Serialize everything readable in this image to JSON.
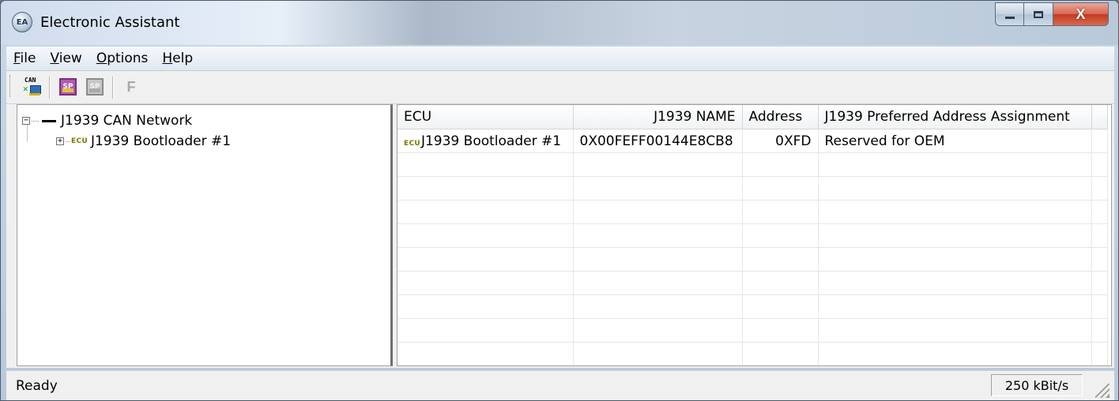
{
  "window": {
    "title": "Electronic Assistant",
    "app_icon": "ea-logo-icon",
    "controls": {
      "minimize": "minimize-icon",
      "maximize": "maximize-icon",
      "close": "close-icon",
      "close_glyph": "X"
    }
  },
  "menu": [
    {
      "label": "File",
      "accel": "F",
      "rest": "ile"
    },
    {
      "label": "View",
      "accel": "V",
      "rest": "iew"
    },
    {
      "label": "Options",
      "accel": "O",
      "rest": "ptions"
    },
    {
      "label": "Help",
      "accel": "H",
      "rest": "elp"
    }
  ],
  "toolbar": {
    "can_icon_text": "CAN",
    "sp_icon_text": "SP",
    "f_label": "F"
  },
  "tree": {
    "root": {
      "expander": "−",
      "label": "J1939 CAN Network"
    },
    "child": {
      "expander": "+",
      "icon_text": "ECU",
      "label": "J1939 Bootloader #1"
    }
  },
  "table": {
    "columns": [
      "ECU",
      "J1939 NAME",
      "Address",
      "J1939 Preferred Address Assignment"
    ],
    "rows": [
      {
        "icon_text": "ECU",
        "ecu": "J1939 Bootloader #1",
        "name": "0X00FEFF00144E8CB8",
        "address": "0XFD",
        "assignment": "Reserved for OEM"
      }
    ]
  },
  "status": {
    "text": "Ready",
    "baud": "250 kBit/s"
  },
  "colors": {
    "title_gradient": "#cfdced",
    "close_button": "#c33a1f",
    "ecu_icon": "#7a7a00",
    "menubar": "#f5f8fc"
  }
}
